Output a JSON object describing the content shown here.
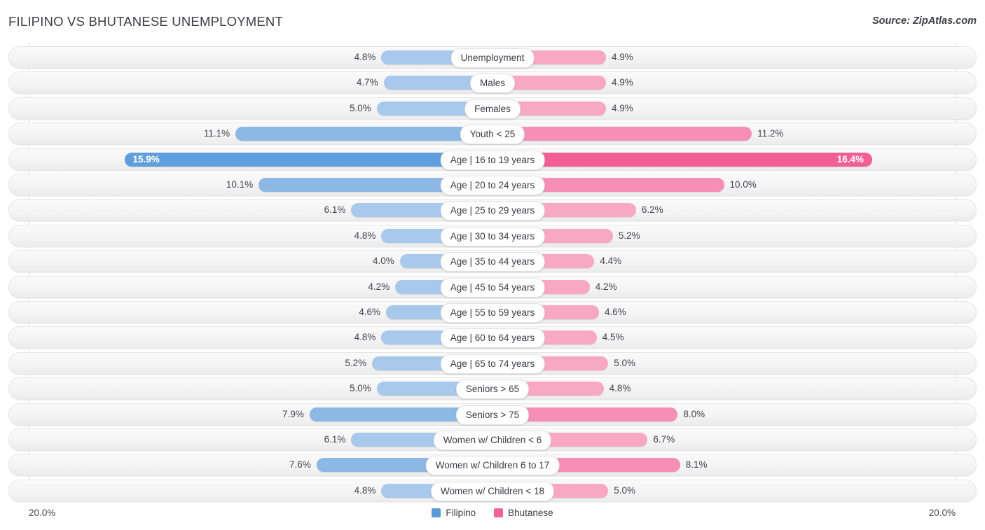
{
  "header": {
    "title": "FILIPINO VS BHUTANESE UNEMPLOYMENT",
    "source": "Source: ZipAtlas.com"
  },
  "axis": {
    "left_end_label": "20.0%",
    "right_end_label": "20.0%",
    "max": 20.0
  },
  "legend": {
    "items": [
      {
        "label": "Filipino",
        "color": "#5b9bd5"
      },
      {
        "label": "Bhutanese",
        "color": "#f2639a"
      }
    ]
  },
  "colors": {
    "left_light": "#a8c8ec",
    "left_mid": "#8cb8e5",
    "left_dark": "#609fdd",
    "right_light": "#f9a8c4",
    "right_mid": "#f58fb4",
    "right_dark": "#f25f95",
    "track": "#f4f4f4",
    "text": "#44444e"
  },
  "chart_data": {
    "type": "bar",
    "title": "FILIPINO VS BHUTANESE UNEMPLOYMENT",
    "subtitle": "",
    "xlabel": "",
    "ylabel": "",
    "orientation": "horizontal-diverging",
    "xlim": [
      20.0,
      20.0
    ],
    "grid": false,
    "legend_position": "bottom-center",
    "categories": [
      "Unemployment",
      "Males",
      "Females",
      "Youth < 25",
      "Age | 16 to 19 years",
      "Age | 20 to 24 years",
      "Age | 25 to 29 years",
      "Age | 30 to 34 years",
      "Age | 35 to 44 years",
      "Age | 45 to 54 years",
      "Age | 55 to 59 years",
      "Age | 60 to 64 years",
      "Age | 65 to 74 years",
      "Seniors > 65",
      "Seniors > 75",
      "Women w/ Children < 6",
      "Women w/ Children 6 to 17",
      "Women w/ Children < 18"
    ],
    "series": [
      {
        "name": "Filipino",
        "side": "left",
        "values": [
          4.8,
          4.7,
          5.0,
          11.1,
          15.9,
          10.1,
          6.1,
          4.8,
          4.0,
          4.2,
          4.6,
          4.8,
          5.2,
          5.0,
          7.9,
          6.1,
          7.6,
          4.8
        ],
        "labels": [
          "4.8%",
          "4.7%",
          "5.0%",
          "11.1%",
          "15.9%",
          "10.1%",
          "6.1%",
          "4.8%",
          "4.0%",
          "4.2%",
          "4.6%",
          "4.8%",
          "5.2%",
          "5.0%",
          "7.9%",
          "6.1%",
          "7.6%",
          "4.8%"
        ]
      },
      {
        "name": "Bhutanese",
        "side": "right",
        "values": [
          4.9,
          4.9,
          4.9,
          11.2,
          16.4,
          10.0,
          6.2,
          5.2,
          4.4,
          4.2,
          4.6,
          4.5,
          5.0,
          4.8,
          8.0,
          6.7,
          8.1,
          5.0
        ],
        "labels": [
          "4.9%",
          "4.9%",
          "4.9%",
          "11.2%",
          "16.4%",
          "10.0%",
          "6.2%",
          "5.2%",
          "4.4%",
          "4.2%",
          "4.6%",
          "4.5%",
          "5.0%",
          "4.8%",
          "8.0%",
          "6.7%",
          "8.1%",
          "5.0%"
        ]
      }
    ]
  }
}
